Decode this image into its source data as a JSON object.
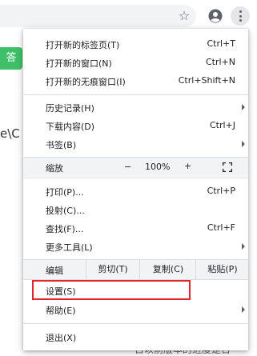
{
  "page": {
    "green_button_label": "答",
    "path_text": "e\\C",
    "bottom_text": "日以前版本的进度是日"
  },
  "menu": {
    "new_tab": {
      "label": "打开新的标签页(T)",
      "shortcut": "Ctrl+T"
    },
    "new_window": {
      "label": "打开新的窗口(N)",
      "shortcut": "Ctrl+N"
    },
    "incognito": {
      "label": "打开新的无痕窗口(I)",
      "shortcut": "Ctrl+Shift+N"
    },
    "history": {
      "label": "历史记录(H)"
    },
    "downloads": {
      "label": "下载内容(D)",
      "shortcut": "Ctrl+J"
    },
    "bookmarks": {
      "label": "书签(B)"
    },
    "zoom": {
      "label": "缩放",
      "minus": "−",
      "value": "100%",
      "plus": "+"
    },
    "print": {
      "label": "打印(P)...",
      "shortcut": "Ctrl+P"
    },
    "cast": {
      "label": "投射(C)..."
    },
    "find": {
      "label": "查找(F)...",
      "shortcut": "Ctrl+F"
    },
    "more_tools": {
      "label": "更多工具(L)"
    },
    "edit": {
      "label": "编辑",
      "cut": "剪切(T)",
      "copy": "复制(C)",
      "paste": "粘贴(P)"
    },
    "settings": {
      "label": "设置(S)"
    },
    "help": {
      "label": "帮助(E)"
    },
    "exit": {
      "label": "退出(X)"
    }
  },
  "colors": {
    "highlight": "#e0262d",
    "accent_green": "#3fbf69"
  }
}
